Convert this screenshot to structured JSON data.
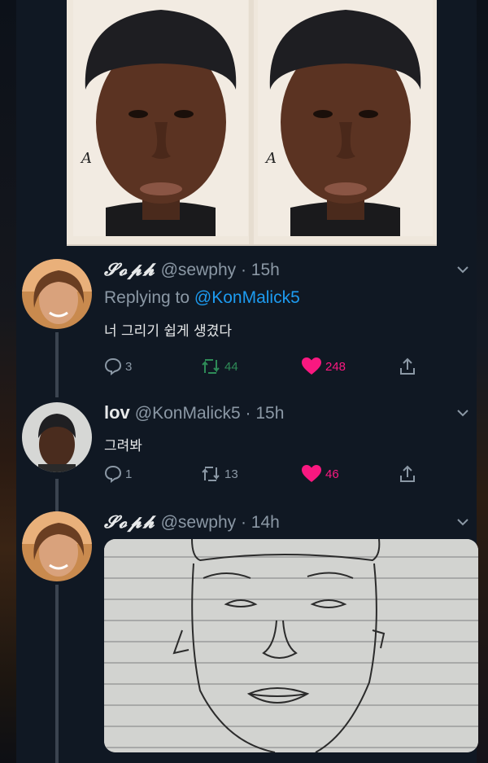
{
  "tweets": [
    {
      "name": "𝓢𝓸𝓹𝓱",
      "handle": "@sewphy",
      "time": "· 15h",
      "replying_prefix": "Replying to",
      "replying_to": "@KonMalick5",
      "text": "너 그리기 쉽게 생겼다",
      "replies": "3",
      "retweets": "44",
      "likes": "248"
    },
    {
      "name": "lov",
      "handle": "@KonMalick5",
      "time": "· 15h",
      "text": "그려봐",
      "replies": "1",
      "retweets": "13",
      "likes": "46"
    },
    {
      "name": "𝓢𝓸𝓹𝓱",
      "handle": "@sewphy",
      "time": "· 14h"
    }
  ],
  "icons": {
    "reply": "speech-bubble-icon",
    "retweet": "retweet-arrows-icon",
    "like": "heart-icon",
    "share": "share-upload-icon",
    "more": "chevron-down-icon"
  },
  "colors": {
    "background": "#101823",
    "mention": "#1d9bf0",
    "like": "#f91880",
    "retweet": "#2e8b57",
    "muted": "#8b98a5"
  }
}
